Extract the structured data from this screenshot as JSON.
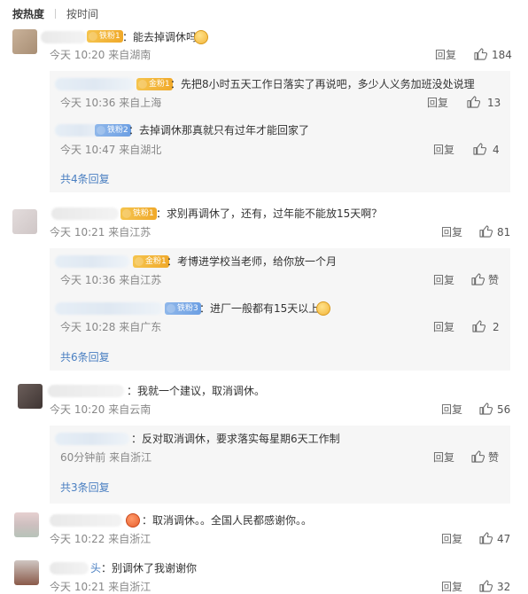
{
  "sort": {
    "hot": "按热度",
    "time": "按时间"
  },
  "labels": {
    "reply": "回复",
    "like_word": "赞"
  },
  "comments": [
    {
      "text": "：能去掉调休吗",
      "meta": "今天 10:20 来自湖南",
      "likes": "184",
      "badge": "铁粉1",
      "replies": [
        {
          "text": "：先把8小时五天工作日落实了再说吧，多少人义务加班没处说理",
          "meta": "今天 10:36 来自上海",
          "likes": "13",
          "badge": "金粉1"
        },
        {
          "text": "：去掉调休那真就只有过年才能回家了",
          "meta": "今天 10:47 来自湖北",
          "likes": "4",
          "badge": "铁粉2"
        }
      ],
      "more": "共4条回复"
    },
    {
      "text": "：求别再调休了，还有，过年能不能放15天啊？",
      "meta": "今天 10:21 来自江苏",
      "likes": "81",
      "badge": "铁粉1",
      "replies": [
        {
          "text": "：考博进学校当老师，给你放一个月",
          "meta": "今天 10:36 来自江苏",
          "likes": "赞",
          "badge": "金粉1"
        },
        {
          "text": "：进厂一般都有15天以上",
          "meta": "今天 10:28 来自广东",
          "likes": "2",
          "badge": "铁粉3"
        }
      ],
      "more": "共6条回复"
    },
    {
      "text": "：我就一个建议，取消调休。",
      "meta": "今天 10:20 来自云南",
      "likes": "56",
      "replies": [
        {
          "text": "：反对取消调休，要求落实每星期6天工作制",
          "meta": "60分钟前 来自浙江",
          "likes": "赞"
        }
      ],
      "more": "共3条回复"
    },
    {
      "text": "：取消调休。。全国人民都感谢你。。",
      "meta": "今天 10:22 来自浙江",
      "likes": "47"
    },
    {
      "name_tail": "头",
      "text": "：别调休了我谢谢你",
      "meta": "今天 10:21 来自浙江",
      "likes": "32"
    }
  ],
  "colors": {
    "link": "#4a7fc1",
    "meta": "#888888",
    "reply_bg": "#f6f6f6"
  },
  "icons": {
    "like": "thumbs-up-icon",
    "emoji": "emoji-face-icon",
    "badge": "fan-badge-icon"
  }
}
